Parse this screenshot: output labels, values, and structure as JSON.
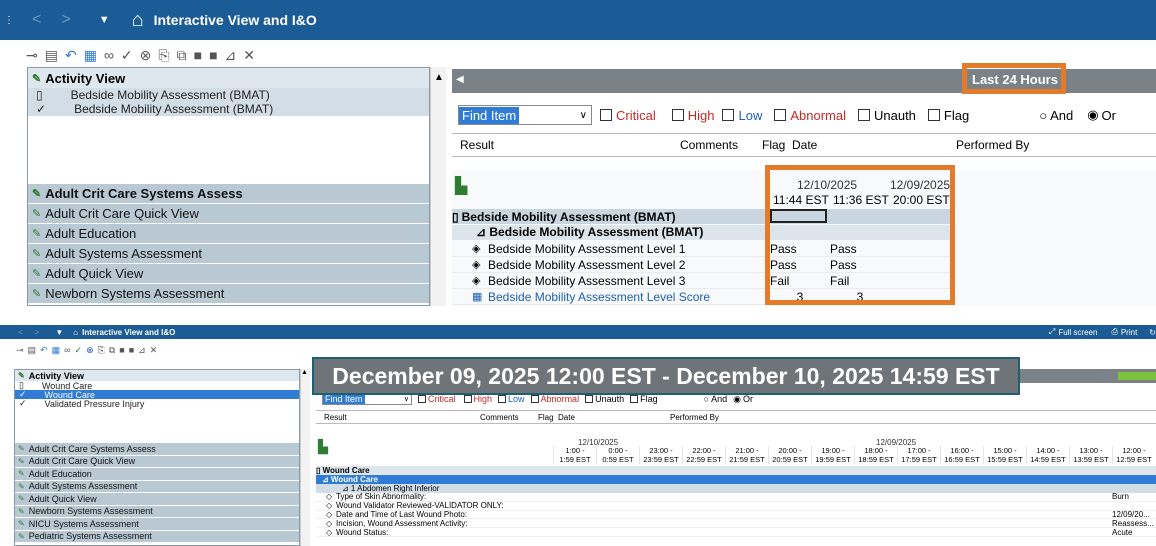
{
  "top": {
    "title": "Interactive View and I&O",
    "nav": {
      "back": "<",
      "fwd": ">",
      "menu": "▼"
    },
    "toolbar_icons": [
      "link-icon",
      "grid-icon",
      "undo-icon",
      "table-icon",
      "glasses-icon",
      "check-icon",
      "cancel-icon",
      "paste-icon",
      "copy-icon",
      "block-icon",
      "block2-icon",
      "chart-icon",
      "close-icon"
    ],
    "left": {
      "header": "Activity View",
      "activity_items": [
        "Bedside Mobility Assessment (BMAT)",
        "Bedside Mobility Assessment (BMAT)"
      ],
      "bands": [
        "Adult Crit Care Systems Assess",
        "Adult Crit Care Quick View",
        "Adult Education",
        "Adult Systems Assessment",
        "Adult Quick View",
        "Newborn Systems Assessment"
      ]
    },
    "range_label": "Last 24 Hours",
    "filter": {
      "find_item": "Find Item",
      "critical": "Critical",
      "high": "High",
      "low": "Low",
      "abnormal": "Abnormal",
      "unauth": "Unauth",
      "flag": "Flag",
      "and": "And",
      "or": "Or"
    },
    "columns": {
      "result": "Result",
      "comments": "Comments",
      "flag": "Flag",
      "date": "Date",
      "performed_by": "Performed By"
    },
    "dates": {
      "d1": "12/10/2025",
      "d2": "12/09/2025"
    },
    "times": [
      "11:44 EST",
      "11:36 EST",
      "20:00 EST"
    ],
    "section": "Bedside Mobility Assessment (BMAT)",
    "subsection": "⊿ Bedside Mobility Assessment (BMAT)",
    "rows": [
      {
        "label": "Bedside Mobility Assessment Level 1",
        "v2": "Pass",
        "v3": "Pass"
      },
      {
        "label": "Bedside Mobility Assessment Level 2",
        "v2": "Pass",
        "v3": "Pass"
      },
      {
        "label": "Bedside Mobility Assessment Level 3",
        "v2": "Fail",
        "v3": "Fail"
      },
      {
        "label": "Bedside Mobility Assessment Level Score",
        "v2": "3",
        "v3": "3"
      }
    ]
  },
  "bottom": {
    "title": "Interactive View and I&O",
    "full_screen": "Full screen",
    "print": "Print",
    "left": {
      "header": "Activity View",
      "items": [
        "Wound Care",
        "Wound Care",
        "Validated Pressure Injury"
      ],
      "bands": [
        "Adult Crit Care Systems Assess",
        "Adult Crit Care Quick View",
        "Adult Education",
        "Adult Systems Assessment",
        "Adult Quick View",
        "Newborn Systems Assessment",
        "NICU Systems Assessment",
        "Pediatric Systems Assessment"
      ]
    },
    "banner": "December 09, 2025 12:00 EST - December 10, 2025 14:59 EST",
    "filter": {
      "find_item": "Find Item",
      "critical": "Critical",
      "high": "High",
      "low": "Low",
      "abnormal": "Abnormal",
      "unauth": "Unauth",
      "flag": "Flag",
      "and": "And",
      "or": "Or"
    },
    "columns": {
      "result": "Result",
      "comments": "Comments",
      "flag": "Flag",
      "date": "Date",
      "performed_by": "Performed By"
    },
    "dates": {
      "d1": "12/10/2025",
      "d2": "12/09/2025"
    },
    "time_cols": [
      [
        "1:00 -",
        "1:59 EST"
      ],
      [
        "0:00 -",
        "0:59 EST"
      ],
      [
        "23:00 -",
        "23:59 EST"
      ],
      [
        "22:00 -",
        "22:59 EST"
      ],
      [
        "21:00 -",
        "21:59 EST"
      ],
      [
        "20:00 -",
        "20:59 EST"
      ],
      [
        "19:00 -",
        "19:59 EST"
      ],
      [
        "18:00 -",
        "18:59 EST"
      ],
      [
        "17:00 -",
        "17:59 EST"
      ],
      [
        "16:00 -",
        "16:59 EST"
      ],
      [
        "15:00 -",
        "15:59 EST"
      ],
      [
        "14:00 -",
        "14:59 EST"
      ],
      [
        "13:00 -",
        "13:59 EST"
      ],
      [
        "12:00 -",
        "12:59 EST"
      ]
    ],
    "section": "Wound Care",
    "subsection": "⊿ Wound Care",
    "subsub": "⊿ 1 Abdomen Right Inferior",
    "rows": [
      {
        "label": "Type of Skin Abnormality:",
        "val": "Burn"
      },
      {
        "label": "Wound Validator Reviewed-VALIDATOR ONLY:",
        "val": ""
      },
      {
        "label": "Date and Time of Last Wound Photo:",
        "val": "12/09/20..."
      },
      {
        "label": "Incision, Wound Assessment Activity:",
        "val": "Reassess..."
      },
      {
        "label": "Wound Status:",
        "val": "Acute"
      }
    ]
  }
}
